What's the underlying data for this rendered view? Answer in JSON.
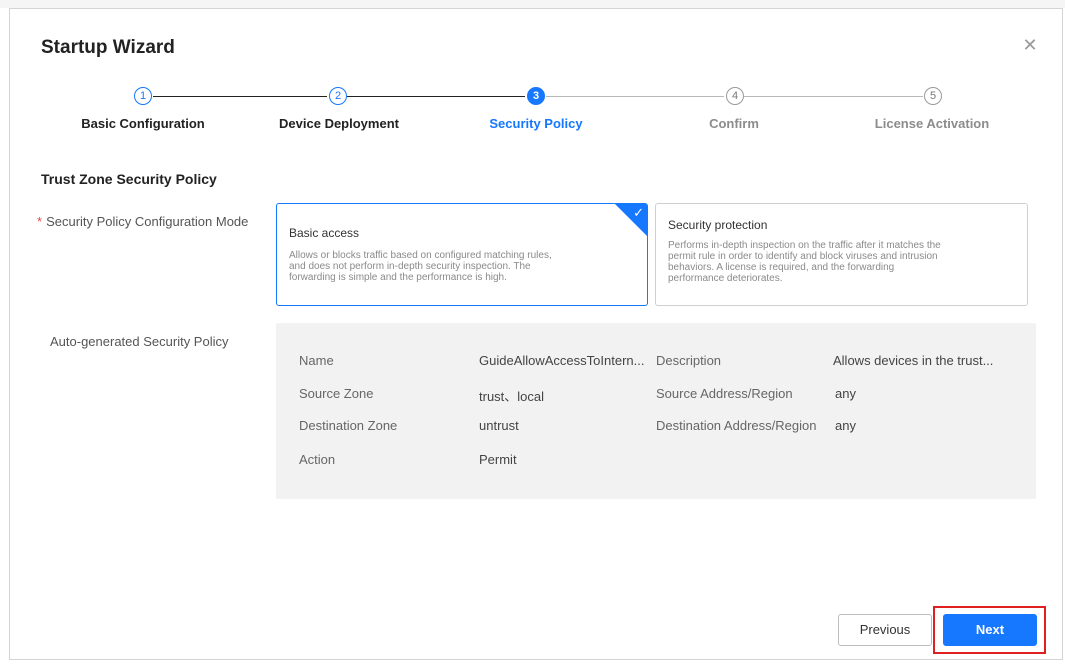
{
  "dialog": {
    "title": "Startup Wizard",
    "close_icon": "close-icon"
  },
  "steps": [
    {
      "number": "1",
      "label": "Basic Configuration",
      "state": "done"
    },
    {
      "number": "2",
      "label": "Device Deployment",
      "state": "done"
    },
    {
      "number": "3",
      "label": "Security Policy",
      "state": "active"
    },
    {
      "number": "4",
      "label": "Confirm",
      "state": "todo"
    },
    {
      "number": "5",
      "label": "License Activation",
      "state": "todo"
    }
  ],
  "section": {
    "title": "Trust Zone Security Policy"
  },
  "mode_field": {
    "label": "Security Policy Configuration Mode",
    "required_mark": "*",
    "options": [
      {
        "title": "Basic access",
        "description_lines": [
          "Allows or blocks traffic based on configured matching rules,",
          "and does not perform in-depth security inspection. The",
          "forwarding is simple and the performance is high."
        ],
        "selected": true
      },
      {
        "title": "Security protection",
        "description_lines": [
          "Performs in-depth inspection on the traffic after it matches the",
          "permit rule in order to identify and block viruses and intrusion",
          "behaviors. A license is required, and the forwarding",
          "performance deteriorates."
        ],
        "selected": false
      }
    ]
  },
  "policy": {
    "label": "Auto-generated Security Policy",
    "fields": {
      "name_key": "Name",
      "name_value": "GuideAllowAccessToIntern...",
      "description_key": "Description",
      "description_value": "Allows devices in the trust...",
      "source_zone_key": "Source Zone",
      "source_zone_value": "trust、local",
      "source_address_key": "Source Address/Region",
      "source_address_value": "any",
      "destination_zone_key": "Destination Zone",
      "destination_zone_value": "untrust",
      "destination_address_key": "Destination Address/Region",
      "destination_address_value": "any",
      "action_key": "Action",
      "action_value": "Permit"
    }
  },
  "buttons": {
    "previous": "Previous",
    "next": "Next"
  },
  "colors": {
    "accent": "#1677ff",
    "highlight": "#e02020",
    "required": "#e5484d"
  }
}
